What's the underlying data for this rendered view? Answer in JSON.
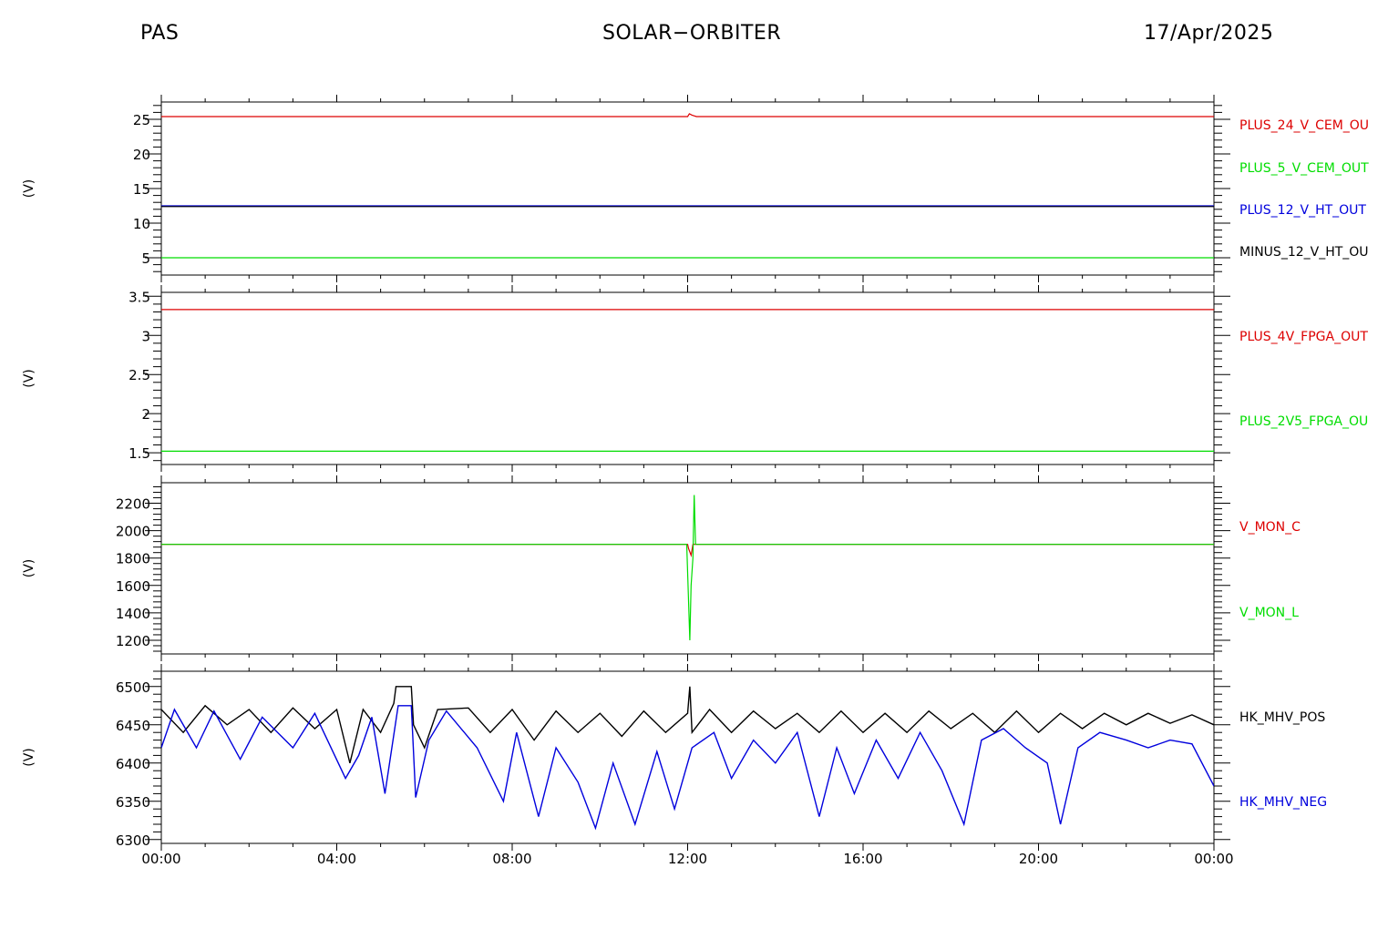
{
  "header": {
    "left": "PAS",
    "center": "SOLAR−ORBITER",
    "right": "17/Apr/2025"
  },
  "time_axis": {
    "ticks": [
      "00:00",
      "04:00",
      "08:00",
      "12:00",
      "16:00",
      "20:00",
      "00:00"
    ],
    "range_hours": [
      0,
      24
    ]
  },
  "colors": {
    "red": "#dd0000",
    "green": "#00dd00",
    "blue": "#0000dd",
    "black": "#000000"
  },
  "chart_data": [
    {
      "type": "line",
      "ylabel": "(V)",
      "ylim": [
        2.5,
        27.5
      ],
      "yticks": [
        5,
        10,
        15,
        20,
        25
      ],
      "series": [
        {
          "name": "PLUS_24_V_CEM_OU",
          "color": "#dd0000",
          "points": [
            [
              0,
              25.4
            ],
            [
              12.0,
              25.4
            ],
            [
              12.04,
              25.8
            ],
            [
              12.1,
              25.6
            ],
            [
              12.2,
              25.4
            ],
            [
              24,
              25.4
            ]
          ]
        },
        {
          "name": "PLUS_5_V_CEM_OUT",
          "color": "#00dd00",
          "points": [
            [
              0,
              5.0
            ],
            [
              24,
              5.0
            ]
          ]
        },
        {
          "name": "PLUS_12_V_HT_OUT",
          "color": "#0000dd",
          "points": [
            [
              0,
              12.5
            ],
            [
              24,
              12.5
            ]
          ]
        },
        {
          "name": "MINUS_12_V_HT_OU",
          "color": "#000000",
          "points": [
            [
              0,
              12.4
            ],
            [
              24,
              12.4
            ]
          ]
        }
      ]
    },
    {
      "type": "line",
      "ylabel": "(V)",
      "ylim": [
        1.35,
        3.55
      ],
      "yticks": [
        1.5,
        2.0,
        2.5,
        3.0,
        3.5
      ],
      "series": [
        {
          "name": "PLUS_4V_FPGA_OUT",
          "color": "#dd0000",
          "points": [
            [
              0,
              3.33
            ],
            [
              24,
              3.33
            ]
          ]
        },
        {
          "name": "PLUS_2V5_FPGA_OU",
          "color": "#00dd00",
          "points": [
            [
              0,
              1.52
            ],
            [
              24,
              1.52
            ]
          ]
        }
      ]
    },
    {
      "type": "line",
      "ylabel": "(V)",
      "ylim": [
        1100,
        2350
      ],
      "yticks": [
        1200,
        1400,
        1600,
        1800,
        2000,
        2200
      ],
      "series": [
        {
          "name": "V_MON_C",
          "color": "#dd0000",
          "points": [
            [
              0,
              1900
            ],
            [
              12.0,
              1900
            ],
            [
              12.02,
              1870
            ],
            [
              12.08,
              1820
            ],
            [
              12.12,
              1900
            ],
            [
              24,
              1900
            ]
          ]
        },
        {
          "name": "V_MON_L",
          "color": "#00dd00",
          "points": [
            [
              0,
              1900
            ],
            [
              11.98,
              1900
            ],
            [
              12.05,
              1200
            ],
            [
              12.08,
              1600
            ],
            [
              12.12,
              1800
            ],
            [
              12.15,
              2260
            ],
            [
              12.18,
              1900
            ],
            [
              24,
              1900
            ]
          ]
        }
      ]
    },
    {
      "type": "line",
      "ylabel": "(V)",
      "ylim": [
        6295,
        6520
      ],
      "yticks": [
        6300,
        6350,
        6400,
        6450,
        6500
      ],
      "series": [
        {
          "name": "HK_MHV_POS",
          "color": "#000000",
          "points": [
            [
              0,
              6470
            ],
            [
              0.5,
              6440
            ],
            [
              1.0,
              6475
            ],
            [
              1.5,
              6450
            ],
            [
              2.0,
              6470
            ],
            [
              2.5,
              6440
            ],
            [
              3.0,
              6472
            ],
            [
              3.5,
              6445
            ],
            [
              4.0,
              6470
            ],
            [
              4.3,
              6400
            ],
            [
              4.6,
              6470
            ],
            [
              5.0,
              6440
            ],
            [
              5.3,
              6478
            ],
            [
              5.35,
              6500
            ],
            [
              5.7,
              6500
            ],
            [
              5.75,
              6450
            ],
            [
              6.0,
              6420
            ],
            [
              6.3,
              6470
            ],
            [
              7.0,
              6472
            ],
            [
              7.5,
              6440
            ],
            [
              8.0,
              6470
            ],
            [
              8.5,
              6430
            ],
            [
              9.0,
              6468
            ],
            [
              9.5,
              6440
            ],
            [
              10.0,
              6465
            ],
            [
              10.5,
              6435
            ],
            [
              11.0,
              6468
            ],
            [
              11.5,
              6440
            ],
            [
              12.0,
              6465
            ],
            [
              12.05,
              6500
            ],
            [
              12.1,
              6440
            ],
            [
              12.5,
              6470
            ],
            [
              13.0,
              6440
            ],
            [
              13.5,
              6468
            ],
            [
              14.0,
              6445
            ],
            [
              14.5,
              6465
            ],
            [
              15.0,
              6440
            ],
            [
              15.5,
              6468
            ],
            [
              16.0,
              6440
            ],
            [
              16.5,
              6465
            ],
            [
              17.0,
              6440
            ],
            [
              17.5,
              6468
            ],
            [
              18.0,
              6445
            ],
            [
              18.5,
              6465
            ],
            [
              19.0,
              6440
            ],
            [
              19.5,
              6468
            ],
            [
              20.0,
              6440
            ],
            [
              20.5,
              6465
            ],
            [
              21.0,
              6445
            ],
            [
              21.5,
              6465
            ],
            [
              22.0,
              6450
            ],
            [
              22.5,
              6465
            ],
            [
              23.0,
              6452
            ],
            [
              23.5,
              6463
            ],
            [
              24.0,
              6450
            ]
          ]
        },
        {
          "name": "HK_MHV_NEG",
          "color": "#0000dd",
          "points": [
            [
              0,
              6420
            ],
            [
              0.3,
              6470
            ],
            [
              0.8,
              6420
            ],
            [
              1.2,
              6468
            ],
            [
              1.8,
              6405
            ],
            [
              2.3,
              6460
            ],
            [
              3.0,
              6420
            ],
            [
              3.5,
              6465
            ],
            [
              4.2,
              6380
            ],
            [
              4.5,
              6410
            ],
            [
              4.8,
              6460
            ],
            [
              5.1,
              6360
            ],
            [
              5.4,
              6475
            ],
            [
              5.7,
              6475
            ],
            [
              5.8,
              6355
            ],
            [
              6.1,
              6430
            ],
            [
              6.5,
              6468
            ],
            [
              7.2,
              6420
            ],
            [
              7.8,
              6350
            ],
            [
              8.1,
              6440
            ],
            [
              8.6,
              6330
            ],
            [
              9.0,
              6420
            ],
            [
              9.5,
              6375
            ],
            [
              9.9,
              6315
            ],
            [
              10.3,
              6400
            ],
            [
              10.8,
              6320
            ],
            [
              11.3,
              6415
            ],
            [
              11.7,
              6340
            ],
            [
              12.1,
              6420
            ],
            [
              12.6,
              6440
            ],
            [
              13.0,
              6380
            ],
            [
              13.5,
              6430
            ],
            [
              14.0,
              6400
            ],
            [
              14.5,
              6440
            ],
            [
              15.0,
              6330
            ],
            [
              15.4,
              6420
            ],
            [
              15.8,
              6360
            ],
            [
              16.3,
              6430
            ],
            [
              16.8,
              6380
            ],
            [
              17.3,
              6440
            ],
            [
              17.8,
              6390
            ],
            [
              18.3,
              6320
            ],
            [
              18.7,
              6430
            ],
            [
              19.2,
              6445
            ],
            [
              19.7,
              6420
            ],
            [
              20.2,
              6400
            ],
            [
              20.5,
              6320
            ],
            [
              20.9,
              6420
            ],
            [
              21.4,
              6440
            ],
            [
              22.0,
              6430
            ],
            [
              22.5,
              6420
            ],
            [
              23.0,
              6430
            ],
            [
              23.5,
              6425
            ],
            [
              24.0,
              6370
            ]
          ]
        }
      ]
    }
  ]
}
